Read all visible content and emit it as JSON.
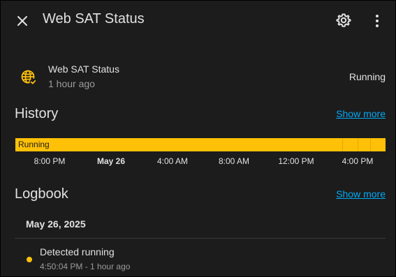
{
  "header": {
    "title": "Web SAT Status",
    "close_icon": "close-icon",
    "settings_icon": "gear-icon",
    "more_icon": "more-vert-icon"
  },
  "entity": {
    "icon": "web-check-icon",
    "name": "Web SAT Status",
    "last_changed": "1 hour ago",
    "state": "Running",
    "accent_color": "#ffc107"
  },
  "history": {
    "title": "History",
    "show_more": "Show more",
    "timeline": {
      "state_label": "Running",
      "color": "#ffc107",
      "ticks": [
        "8:00 PM",
        "May 26",
        "4:00 AM",
        "8:00 AM",
        "12:00 PM",
        "4:00 PM"
      ]
    }
  },
  "logbook": {
    "title": "Logbook",
    "show_more": "Show more",
    "date": "May 26, 2025",
    "entries": [
      {
        "message": "Detected running",
        "time": "4:50:04 PM - 1 hour ago"
      }
    ]
  },
  "colors": {
    "background": "#1c1c1c",
    "link": "#03a9f4",
    "accent": "#ffc107"
  }
}
